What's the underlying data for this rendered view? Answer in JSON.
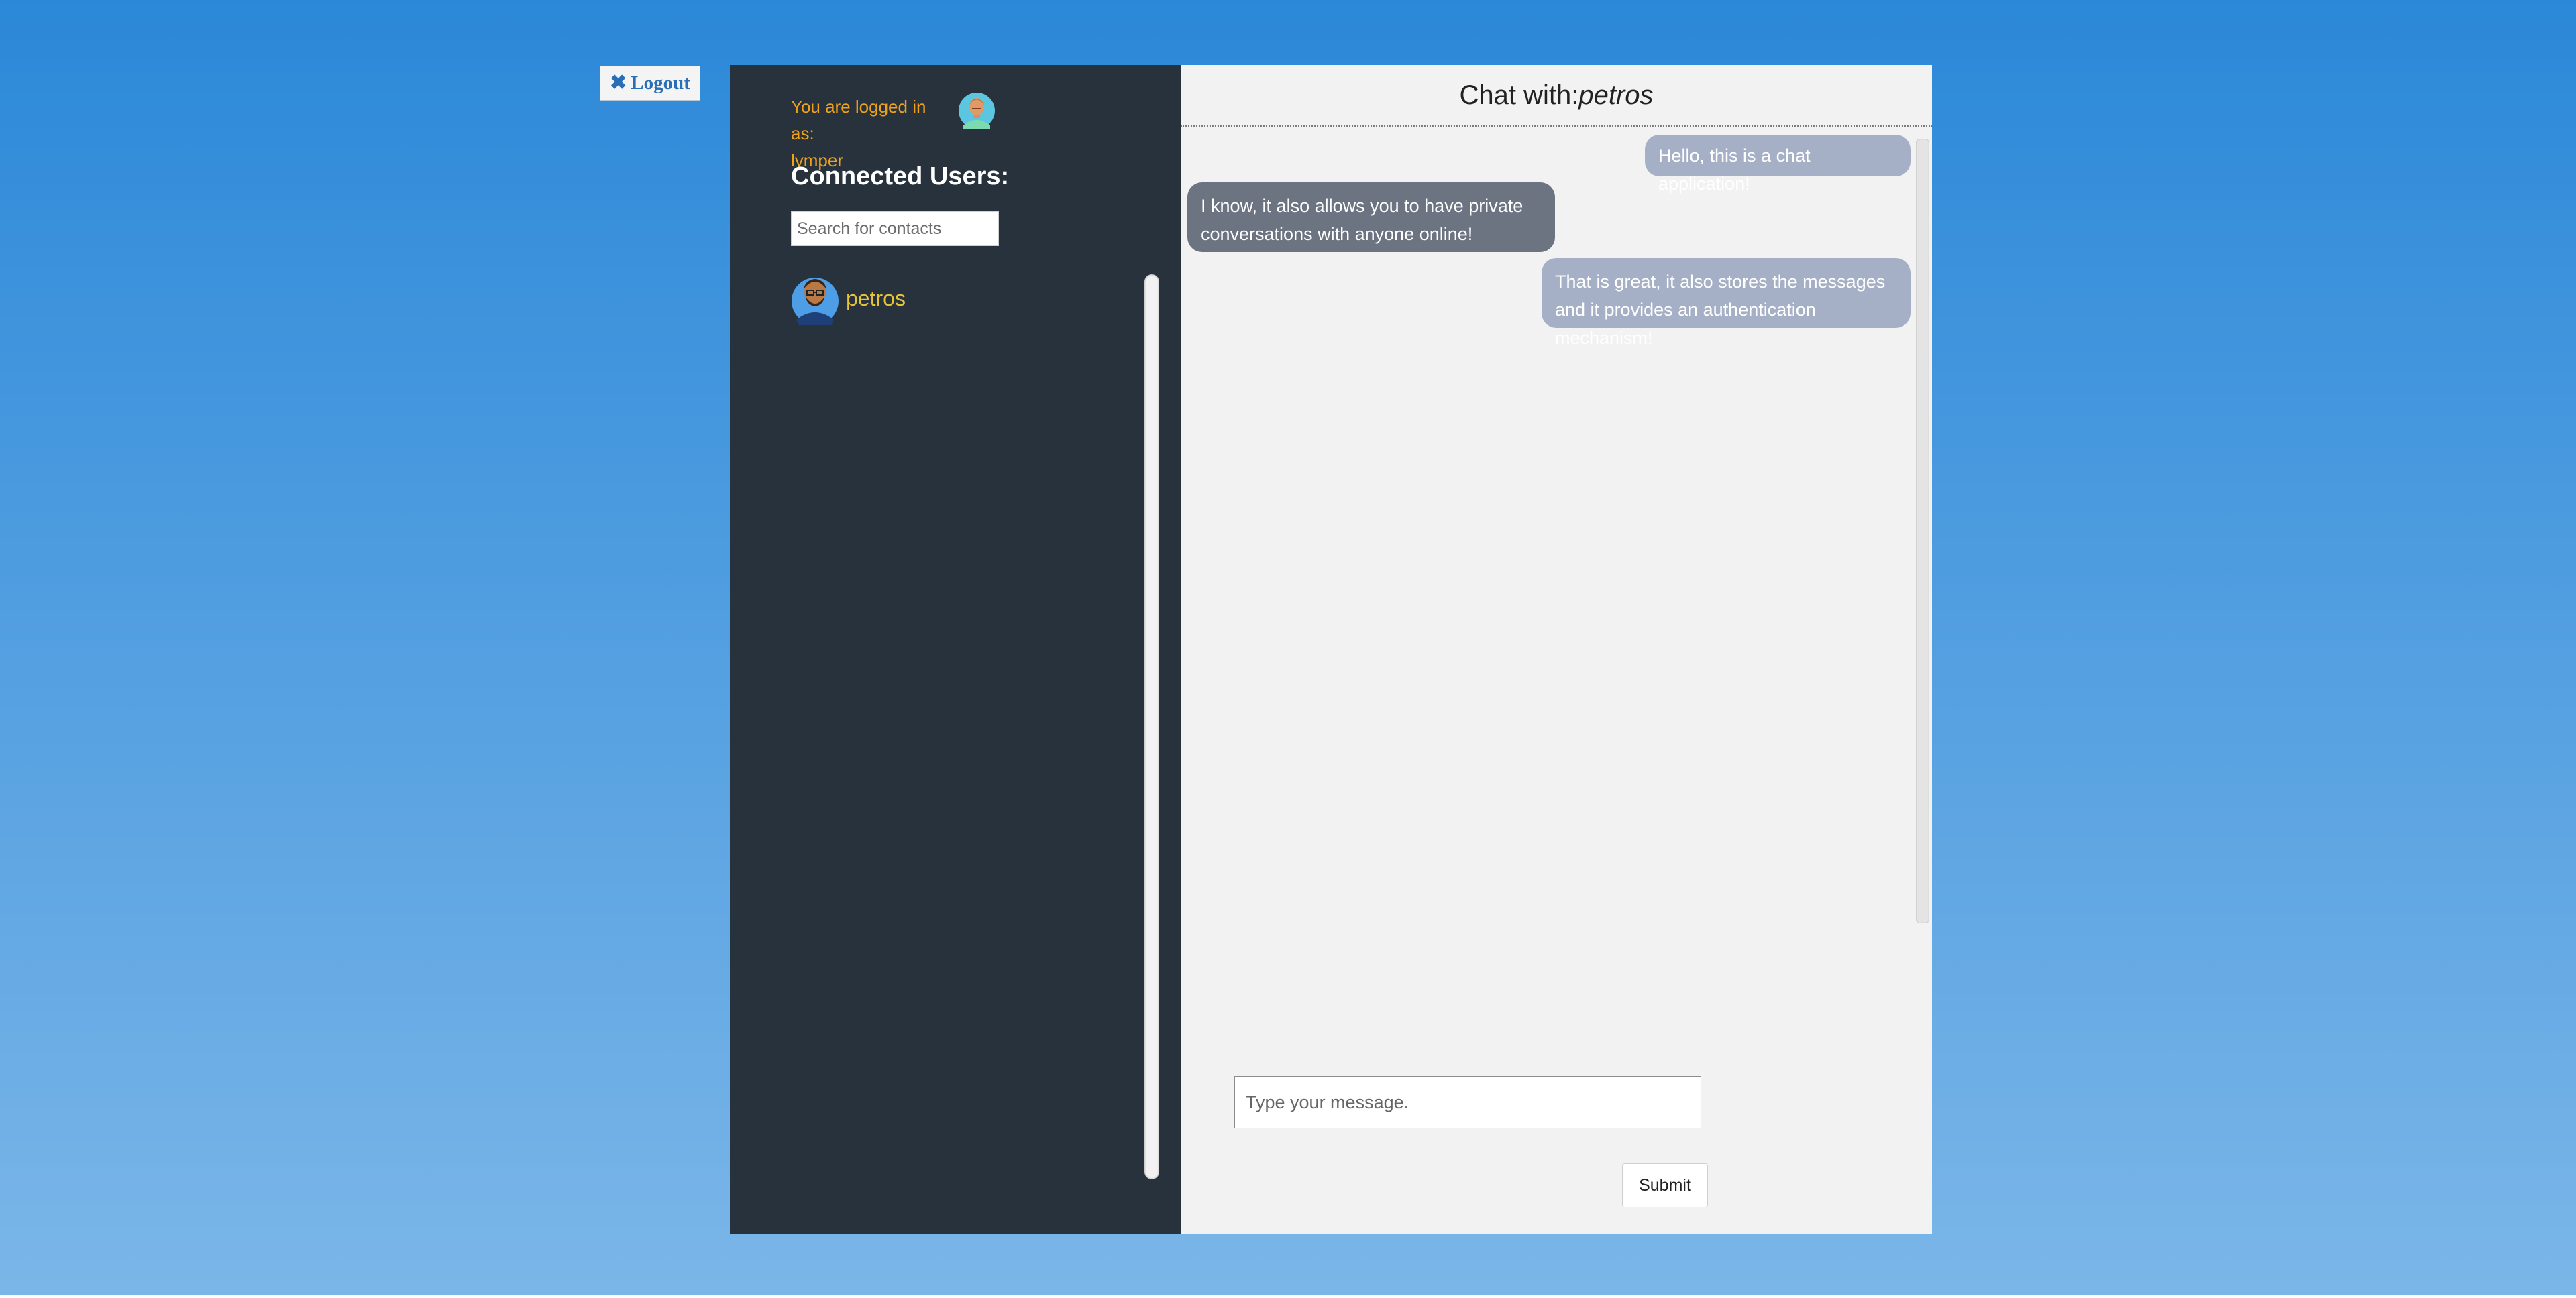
{
  "logout": {
    "icon": "close-icon",
    "label": "Logout"
  },
  "sidebar": {
    "logged_in_prefix": "You are logged in as:",
    "username": "lymper",
    "user_avatar": "user-avatar-icon",
    "connected_title": "Connected Users:",
    "search_placeholder": "Search for contacts",
    "contacts": [
      {
        "name": "petros",
        "avatar": "contact-avatar-icon"
      }
    ]
  },
  "chat": {
    "title_prefix": "Chat with:",
    "partner": "petros",
    "messages": [
      {
        "from": "me",
        "text": "Hello, this is a chat application!"
      },
      {
        "from": "them",
        "text": "I know, it also allows you to have private conversations with anyone online!"
      },
      {
        "from": "me",
        "text": "That is great, it also stores the messages and it provides an authentication mechanism!"
      }
    ],
    "message_placeholder": "Type your message.",
    "submit_label": "Submit"
  },
  "colors": {
    "background_top": "#2b88d8",
    "background_bottom": "#7bb6e8",
    "sidebar_bg": "#27323d",
    "logged_in_text": "#f0a31a",
    "contact_name": "#e6c436",
    "chat_bg": "#f2f2f2",
    "my_bubble": "#a5b0c6",
    "their_bubble": "#6c7381"
  }
}
